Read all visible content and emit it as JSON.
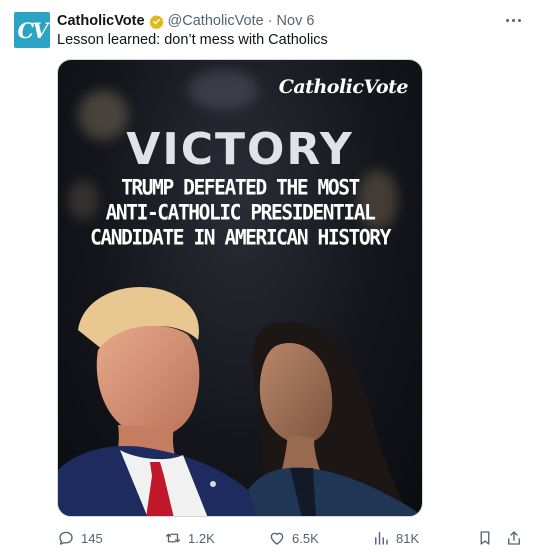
{
  "post": {
    "avatar_text": "CV",
    "display_name": "CatholicVote",
    "handle": "@CatholicVote",
    "separator": "·",
    "date": "Nov 6",
    "text": "Lesson learned: don’t mess with Catholics"
  },
  "media": {
    "brand": "CatholicVote",
    "headline": "VICTORY",
    "sublines": [
      "TRUMP DEFEATED THE MOST",
      "ANTI-CATHOLIC PRESIDENTIAL",
      "CANDIDATE IN AMERICAN HISTORY"
    ]
  },
  "actions": {
    "replies": "145",
    "reposts": "1.2K",
    "likes": "6.5K",
    "views": "81K"
  },
  "colors": {
    "accent": "#1d9bf0",
    "muted": "#536471",
    "verified_gold": "#e2b719",
    "avatar_bg": "#2aa3c4"
  },
  "icons": [
    "verified-badge-icon",
    "more-icon",
    "reply-icon",
    "repost-icon",
    "like-icon",
    "views-icon",
    "bookmark-icon",
    "share-icon"
  ]
}
